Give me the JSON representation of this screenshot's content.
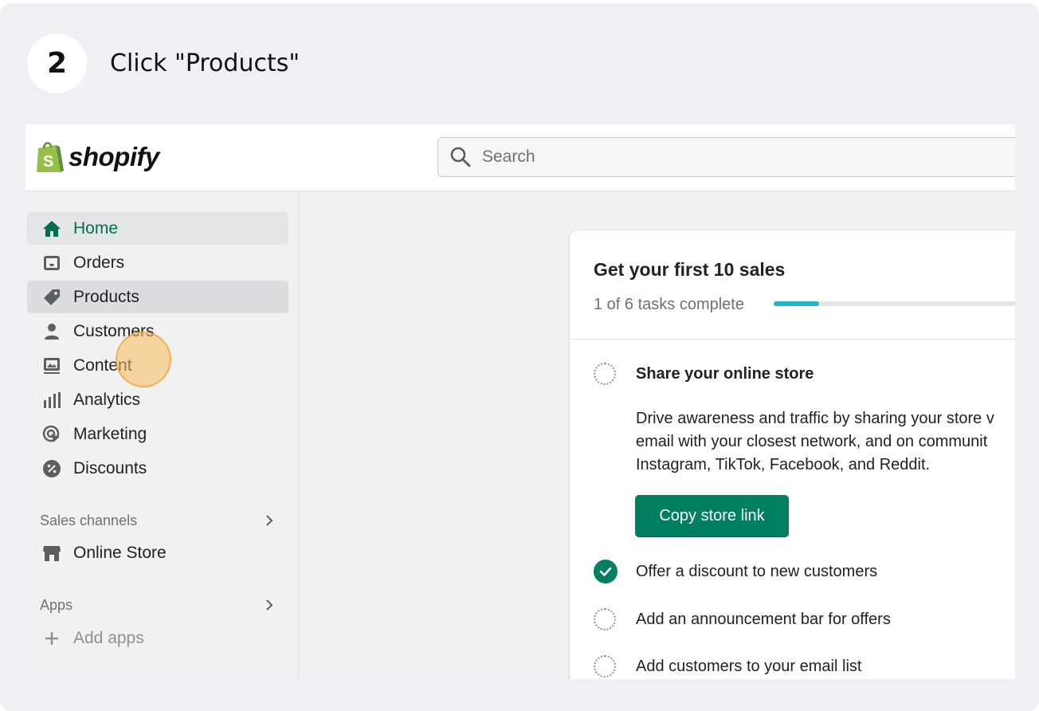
{
  "step": {
    "number": "2",
    "instruction": "Click \"Products\""
  },
  "topbar": {
    "logo_text": "shopify",
    "search_placeholder": "Search"
  },
  "sidebar": {
    "items": [
      {
        "label": "Home",
        "icon": "home-icon"
      },
      {
        "label": "Orders",
        "icon": "inbox-icon"
      },
      {
        "label": "Products",
        "icon": "tag-icon"
      },
      {
        "label": "Customers",
        "icon": "person-icon"
      },
      {
        "label": "Content",
        "icon": "image-icon"
      },
      {
        "label": "Analytics",
        "icon": "bar-chart-icon"
      },
      {
        "label": "Marketing",
        "icon": "target-icon"
      },
      {
        "label": "Discounts",
        "icon": "discount-icon"
      }
    ],
    "sales_channels": {
      "label": "Sales channels",
      "items": [
        {
          "label": "Online Store",
          "icon": "store-icon"
        }
      ]
    },
    "apps": {
      "label": "Apps",
      "add_label": "Add apps"
    }
  },
  "setup_card": {
    "title": "Get your first 10 sales",
    "progress_text": "1 of 6 tasks complete",
    "progress_fraction": 0.1667,
    "tasks": [
      {
        "label": "Share your online store",
        "done": false
      },
      {
        "label": "Offer a discount to new customers",
        "done": true
      },
      {
        "label": "Add an announcement bar for offers",
        "done": false
      },
      {
        "label": "Add customers to your email list",
        "done": false
      }
    ],
    "description_lines": [
      "Drive awareness and traffic by sharing your store v",
      "email with your closest network, and on communit",
      "Instagram, TikTok, Facebook, and Reddit."
    ],
    "copy_button": "Copy store link"
  },
  "colors": {
    "accent": "#008060",
    "home_active": "#006e52",
    "progress": "#1fb6c6",
    "cursor": "#f9b95a"
  }
}
